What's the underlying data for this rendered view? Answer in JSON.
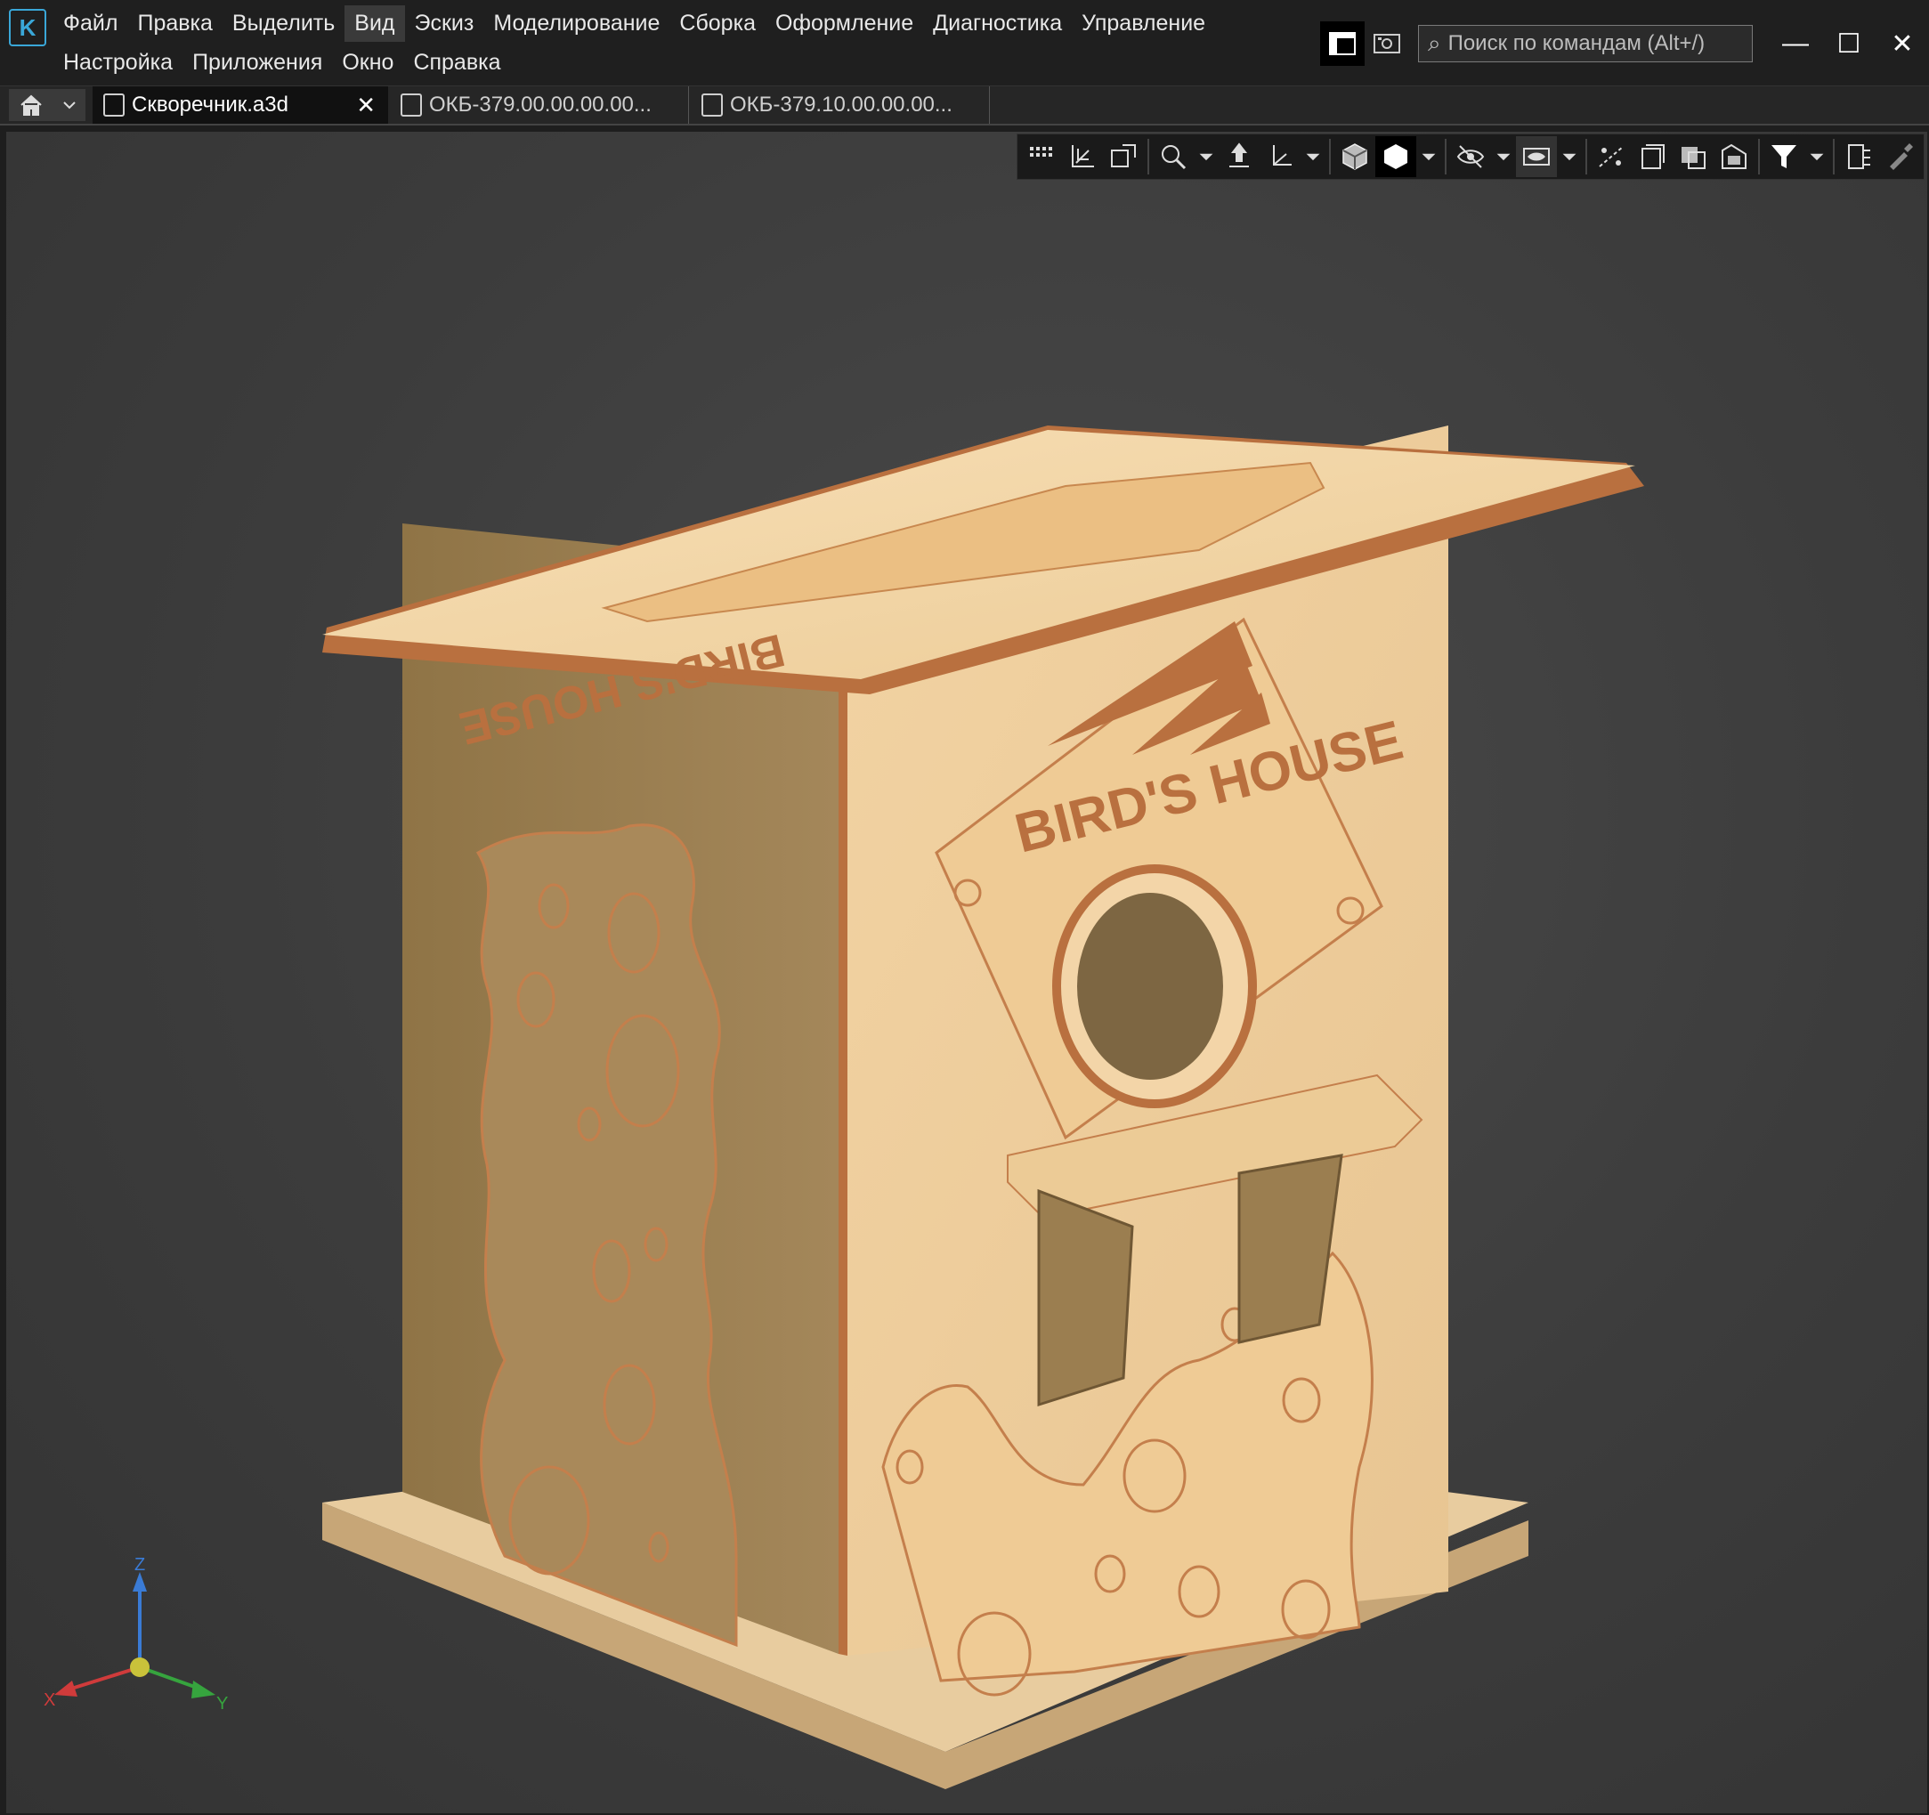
{
  "app": {
    "logo_letter": "K"
  },
  "menu": {
    "row1": [
      "Файл",
      "Правка",
      "Выделить",
      "Вид",
      "Эскиз",
      "Моделирование",
      "Сборка",
      "Оформление",
      "Диагностика",
      "Управление"
    ],
    "row2": [
      "Настройка",
      "Приложения",
      "Окно",
      "Справка"
    ],
    "active": "Вид"
  },
  "search": {
    "placeholder": "Поиск по командам (Alt+/)",
    "icon": "search-icon"
  },
  "window_controls": {
    "minimize": "—",
    "maximize": "☐",
    "close": "✕"
  },
  "tabs": [
    {
      "label": "Скворечник.a3d",
      "active": true,
      "close": "✕"
    },
    {
      "label": "ОКБ-379.00.00.00.00...",
      "active": false
    },
    {
      "label": "ОКБ-379.10.00.00.00...",
      "active": false
    }
  ],
  "toolbar": {
    "icons": [
      "grid-icon",
      "orient-icon",
      "normal-view-icon",
      "zoom-icon",
      "dropdown-icon",
      "pan-icon",
      "axis-icon",
      "dropdown-icon",
      "cube-view-icon",
      "shaded-solid-icon",
      "dropdown-icon",
      "hide-icon",
      "dropdown-icon",
      "visibility-icon",
      "dropdown-icon",
      "section-icon",
      "layers-icon",
      "component-icon",
      "assembly-icon",
      "filter-icon",
      "dropdown-icon",
      "measure-icon",
      "pipette-icon"
    ]
  },
  "model": {
    "roof_engraving": "BIRD'S HOUSE",
    "front_logo": "BIRD'S HOUSE",
    "wood_color": "#e9c998",
    "edge_color": "#b9703f"
  },
  "triad": {
    "z": "Z",
    "x": "X",
    "y": "Y"
  },
  "colors": {
    "accent": "#3aa7d8",
    "viewport_bg": "#3e3e3e"
  }
}
